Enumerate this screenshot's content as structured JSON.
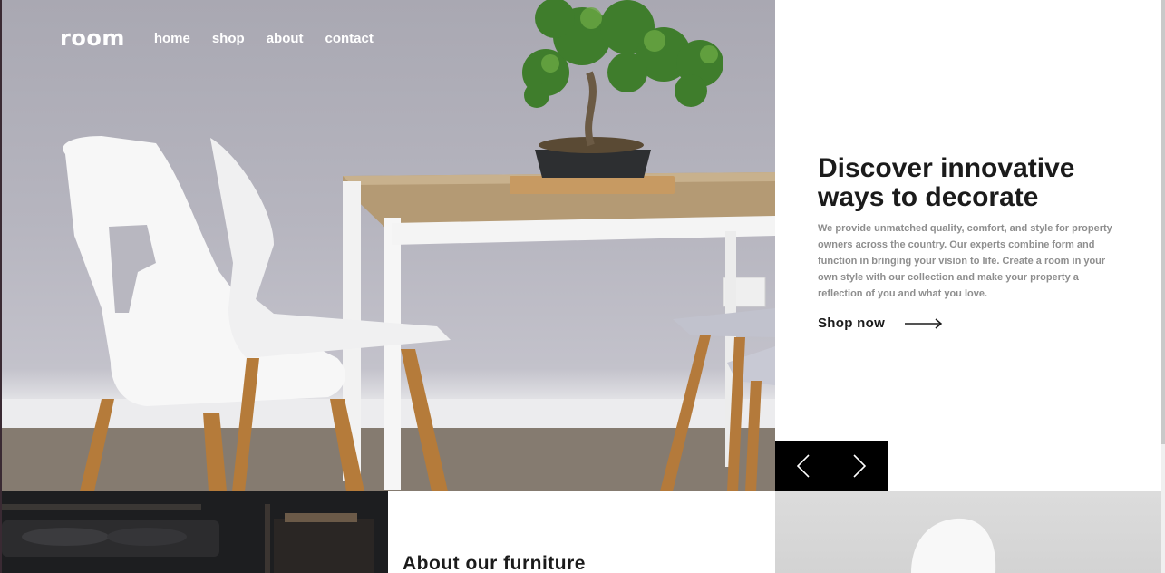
{
  "header": {
    "logo": "room",
    "nav": [
      {
        "label": "home"
      },
      {
        "label": "shop"
      },
      {
        "label": "about"
      },
      {
        "label": "contact"
      }
    ]
  },
  "hero": {
    "headline": "Discover innovative ways to decorate",
    "body": "We provide unmatched quality, comfort, and style for property owners across the country. Our experts combine form and function in bringing your vision to life. Create a room in your own style with our collection and make your property a reflection of you and what you love.",
    "cta_label": "Shop now"
  },
  "slider": {
    "prev_icon": "chevron-left-icon",
    "next_icon": "chevron-right-icon"
  },
  "about": {
    "heading": "About our furniture"
  },
  "colors": {
    "dark": "#000000",
    "text": "#1b1b1b",
    "muted": "#8e8e8e"
  }
}
